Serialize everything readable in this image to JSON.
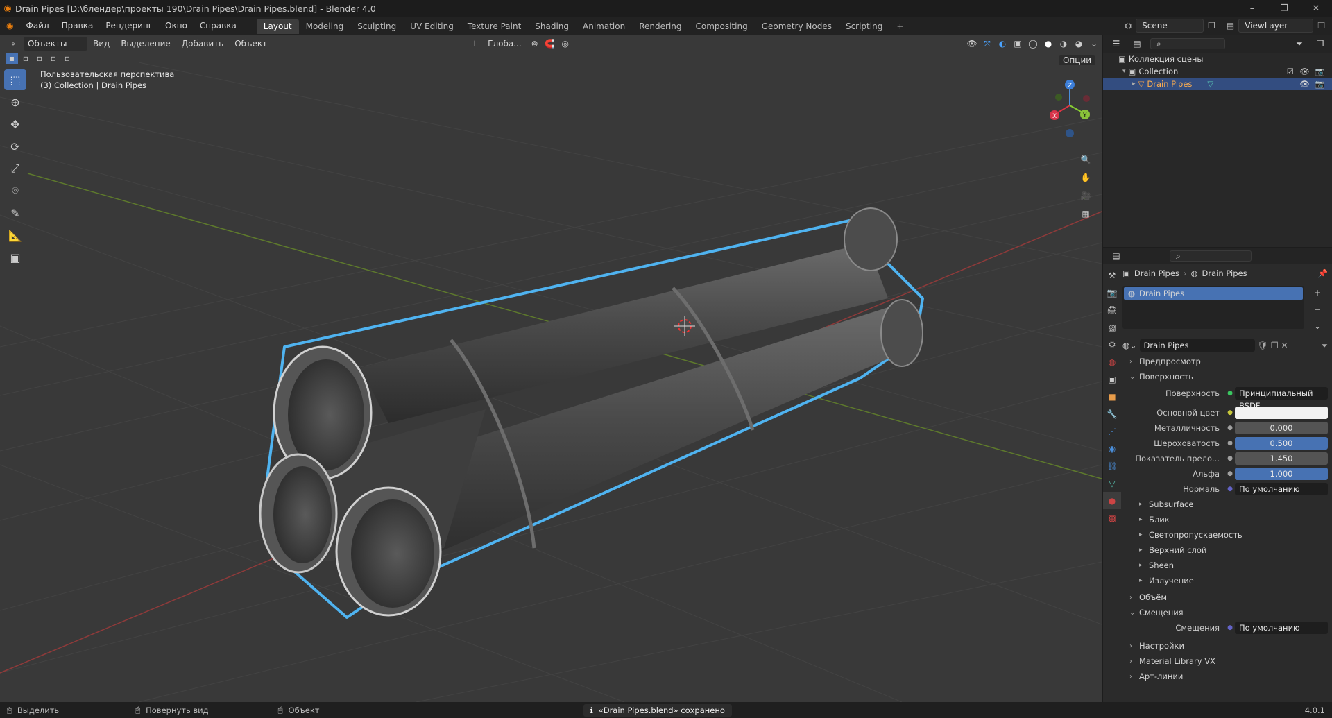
{
  "titlebar": {
    "title": "Drain Pipes [D:\\блендер\\проекты 190\\Drain Pipes\\Drain Pipes.blend] - Blender 4.0",
    "minimize": "–",
    "maximize": "❐",
    "close": "✕"
  },
  "menu": {
    "items": [
      "Файл",
      "Правка",
      "Рендеринг",
      "Окно",
      "Справка"
    ]
  },
  "workspaces": {
    "tabs": [
      "Layout",
      "Modeling",
      "Sculpting",
      "UV Editing",
      "Texture Paint",
      "Shading",
      "Animation",
      "Rendering",
      "Compositing",
      "Geometry Nodes",
      "Scripting"
    ],
    "add": "+"
  },
  "scene": {
    "name": "Scene",
    "view_layer": "ViewLayer"
  },
  "viewport_header": {
    "mode": "Объекты",
    "items": [
      "Вид",
      "Выделение",
      "Добавить",
      "Объект"
    ],
    "transform_orientation": "Глоба...",
    "options": "Опции"
  },
  "viewport": {
    "view_name": "Пользовательская перспектива",
    "collection_info": "(3) Collection | Drain Pipes",
    "gizmo": {
      "x": "X",
      "y": "Y",
      "z": "Z"
    }
  },
  "outliner": {
    "root": "Коллекция сцены",
    "collection": "Collection",
    "object": "Drain Pipes"
  },
  "properties": {
    "breadcrumb": [
      "Drain Pipes",
      "Drain Pipes"
    ],
    "slot": "Drain Pipes",
    "material_name": "Drain Pipes",
    "sections": {
      "preview": "Предпросмотр",
      "surface": "Поверхность",
      "volume": "Объём",
      "displacement": "Смещения",
      "settings": "Настройки",
      "material_library": "Material Library VX",
      "lineart": "Арт-линии"
    },
    "surface_row": {
      "label": "Поверхность",
      "value": "Принципиальный BSDF"
    },
    "fields": [
      {
        "label": "Основной цвет",
        "value": "",
        "style": "white",
        "dot": "#c7c73a"
      },
      {
        "label": "Металличность",
        "value": "0.000",
        "style": "grey",
        "dot": "#a0a0a0"
      },
      {
        "label": "Шероховатость",
        "value": "0.500",
        "style": "blue",
        "dot": "#a0a0a0"
      },
      {
        "label": "Показатель прело...",
        "value": "1.450",
        "style": "grey",
        "dot": "#a0a0a0"
      },
      {
        "label": "Альфа",
        "value": "1.000",
        "style": "blue",
        "dot": "#a0a0a0"
      },
      {
        "label": "Нормаль",
        "value": "По умолчанию",
        "style": "dark",
        "dot": "#6363c7"
      }
    ],
    "subsections": [
      "Subsurface",
      "Блик",
      "Светопропускаемость",
      "Верхний слой",
      "Sheen",
      "Излучение"
    ],
    "displacement_row": {
      "label": "Смещения",
      "value": "По умолчанию"
    }
  },
  "statusbar": {
    "select": "Выделить",
    "rotate": "Повернуть вид",
    "object": "Объект",
    "message": "«Drain Pipes.blend» сохранено",
    "version": "4.0.1"
  }
}
